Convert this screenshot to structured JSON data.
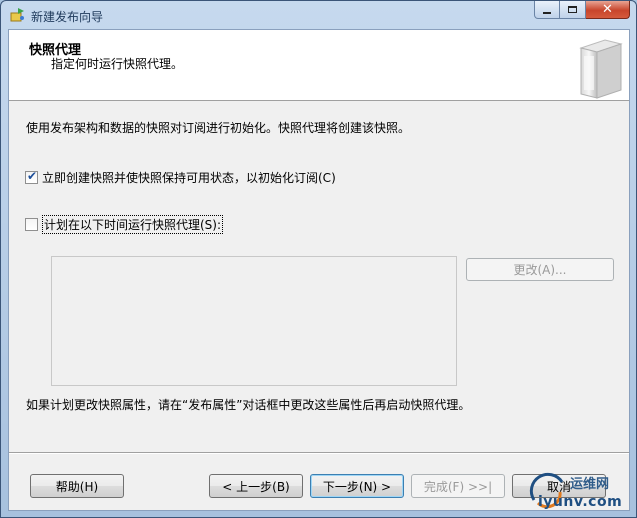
{
  "window": {
    "title": "新建发布向导"
  },
  "header": {
    "title": "快照代理",
    "subtitle": "指定何时运行快照代理。"
  },
  "description": "使用发布架构和数据的快照对订阅进行初始化。快照代理将创建该快照。",
  "options": {
    "create_now": {
      "label": "立即创建快照并使快照保持可用状态，以初始化订阅(C)",
      "checked": true
    },
    "schedule": {
      "label": "计划在以下时间运行快照代理(S):",
      "checked": false
    }
  },
  "schedule": {
    "change_button": "更改(A)..."
  },
  "note": "如果计划更改快照属性，请在“发布属性”对话框中更改这些属性后再启动快照代理。",
  "footer": {
    "help": "帮助(H)",
    "back": "< 上一步(B)",
    "next": "下一步(N) >",
    "finish": "完成(F) >>|",
    "cancel": "取消"
  },
  "watermark": {
    "line1": "运维网",
    "line2": "iyunv.com"
  },
  "colors": {
    "accent": "#3c7fb1",
    "close": "#c8452c",
    "check": "#1d4e99"
  },
  "icons": {
    "app": "wizard-icon",
    "header": "snapshot-agent-icon",
    "minimize": "minimize-icon",
    "maximize": "maximize-icon",
    "close": "close-icon"
  }
}
